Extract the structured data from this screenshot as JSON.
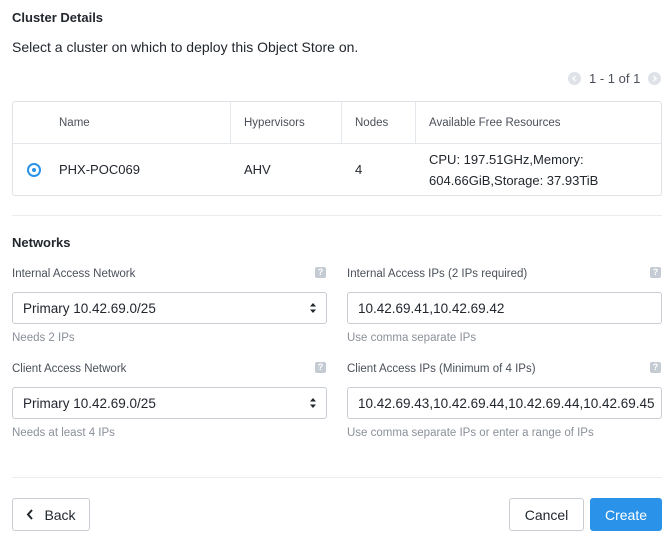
{
  "cluster": {
    "title": "Cluster Details",
    "description": "Select a cluster on which to deploy this Object Store on.",
    "pagination": "1 - 1 of 1",
    "columns": [
      "Name",
      "Hypervisors",
      "Nodes",
      "Available Free Resources"
    ],
    "rows": [
      {
        "selected": true,
        "name": "PHX-POC069",
        "hypervisor": "AHV",
        "nodes": "4",
        "resources_line1": "CPU: 197.51GHz,Memory:",
        "resources_line2": "604.66GiB,Storage: 37.93TiB"
      }
    ]
  },
  "networks": {
    "title": "Networks",
    "internal_network": {
      "label": "Internal Access Network",
      "value": "Primary 10.42.69.0/25",
      "hint": "Needs 2 IPs"
    },
    "internal_ips": {
      "label": "Internal Access IPs (2 IPs required)",
      "value": "10.42.69.41,10.42.69.42",
      "hint": "Use comma separate IPs"
    },
    "client_network": {
      "label": "Client Access Network",
      "value": "Primary 10.42.69.0/25",
      "hint": "Needs at least 4 IPs"
    },
    "client_ips": {
      "label": "Client Access IPs (Minimum of 4 IPs)",
      "value": "10.42.69.43,10.42.69.44,10.42.69.44,10.42.69.45",
      "hint": "Use comma separate IPs or enter a range of IPs"
    },
    "help_glyph": "?"
  },
  "footer": {
    "back_label": "Back",
    "cancel_label": "Cancel",
    "create_label": "Create"
  },
  "colors": {
    "primary": "#2a93e9",
    "border": "#c8cdd3",
    "muted_text": "#8a9099"
  },
  "icons": {
    "pager_prev": "chevron-left-icon",
    "pager_next": "chevron-right-icon",
    "back": "chevron-left-icon",
    "help": "question-icon",
    "select": "updown-arrows-icon"
  }
}
